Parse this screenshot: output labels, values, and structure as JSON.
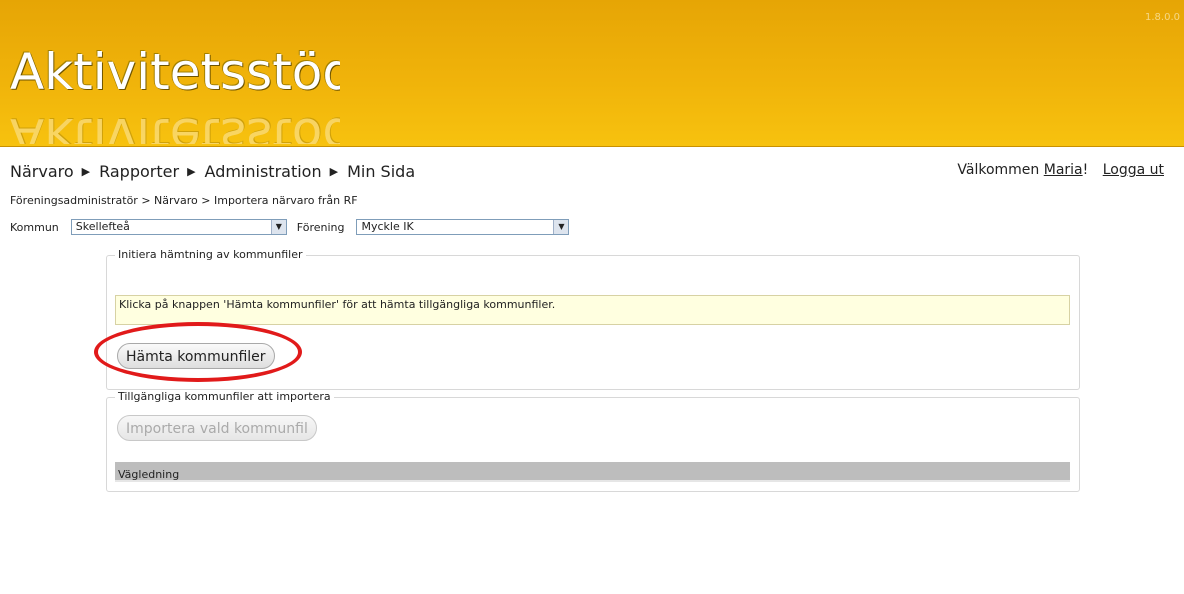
{
  "header": {
    "logo_text": "Aktivitetsstöd",
    "version": "1.8.0.0"
  },
  "nav": {
    "items": [
      "Närvaro",
      "Rapporter",
      "Administration",
      "Min Sida"
    ]
  },
  "user": {
    "welcome": "Välkommen",
    "name": "Maria",
    "suffix": "!",
    "logout": "Logga ut"
  },
  "breadcrumb": "Föreningsadministratör > Närvaro > Importera närvaro från RF",
  "filters": {
    "kommun_label": "Kommun",
    "kommun_value": "Skellefteå",
    "forening_label": "Förening",
    "forening_value": "Myckle IK"
  },
  "panel_fetch": {
    "legend": "Initiera hämtning av kommunfiler",
    "info": "Klicka på knappen 'Hämta kommunfiler' för att hämta tillgängliga kommunfiler.",
    "button": "Hämta kommunfiler"
  },
  "panel_import": {
    "legend": "Tillgängliga kommunfiler att importera",
    "button": "Importera vald kommunfil",
    "guide": "Vägledning"
  },
  "colors": {
    "header": "#f0b30a",
    "highlight_circle": "#e11a1a",
    "info_bg": "#ffffe0"
  }
}
